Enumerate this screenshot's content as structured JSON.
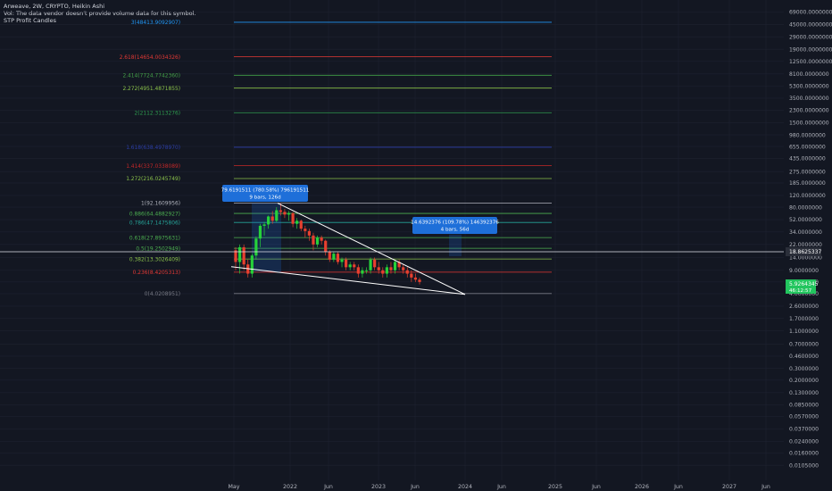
{
  "header": {
    "title": "Arweave, 2W, CRYPTO, Heikin Ashi",
    "vol_note": "Vol: The data vendor doesn't provide volume data for this symbol.",
    "indicator": "STP Profit Candles"
  },
  "colors": {
    "background": "#131722",
    "grid": "#1e2230",
    "axis_text": "#b2b5be",
    "up": "#26d13a",
    "down": "#e8402f",
    "trendline": "#ffffff",
    "measure": "#1e6fd9",
    "last_price": "#22c55e",
    "crosshair_price": "#2a2e39"
  },
  "chart_data": {
    "type": "candlestick",
    "scale": "log",
    "price_labels": [
      "69000.0000000",
      "45000.0000000",
      "29000.0000000",
      "19000.0000000",
      "12500.0000000",
      "8100.0000000",
      "5300.0000000",
      "3500.0000000",
      "2300.0000000",
      "1500.0000000",
      "980.0000000",
      "655.0000000",
      "435.0000000",
      "275.0000000",
      "185.0000000",
      "120.0000000",
      "80.0000000",
      "52.0000000",
      "34.0000000",
      "22.0000000",
      "14.0000000",
      "9.0000000",
      "6.0000000",
      "4.0000000",
      "2.6000000",
      "1.7000000",
      "1.1000000",
      "0.7000000",
      "0.4600000",
      "0.3000000",
      "0.2000000",
      "0.1300000",
      "0.0850000",
      "0.0570000",
      "0.0370000",
      "0.0240000",
      "0.0160000",
      "0.0105000"
    ],
    "time_labels": [
      "May",
      "2022",
      "Jun",
      "2023",
      "Jun",
      "2024",
      "Jun",
      "2025",
      "Jun",
      "2026",
      "Jun",
      "2027",
      "Jun"
    ],
    "fib_levels": [
      {
        "label": "3(48413.9092907)",
        "price": 48413.9,
        "color": "#2196f3"
      },
      {
        "label": "2.618(14654.0034326)",
        "price": 14654.0,
        "color": "#e53935"
      },
      {
        "label": "2.414(7724.7742360)",
        "price": 7724.77,
        "color": "#43a047"
      },
      {
        "label": "2.272(4951.4871855)",
        "price": 4951.49,
        "color": "#8bc34a"
      },
      {
        "label": "2(2112.3113276)",
        "price": 2112.31,
        "color": "#2e9d4f"
      },
      {
        "label": "1.618(638.4978970)",
        "price": 638.5,
        "color": "#2c3ea8"
      },
      {
        "label": "1.414(337.0338089)",
        "price": 337.03,
        "color": "#c62828"
      },
      {
        "label": "1.272(216.0245749)",
        "price": 216.02,
        "color": "#8bc34a"
      },
      {
        "label": "1(92.1609956)",
        "price": 92.16,
        "color": "#b0b3bd"
      },
      {
        "label": "0.886(64.4882927)",
        "price": 64.49,
        "color": "#4caf50"
      },
      {
        "label": "0.786(47.1475806)",
        "price": 47.15,
        "color": "#26a69a"
      },
      {
        "label": "0.618(27.8975631)",
        "price": 27.9,
        "color": "#4caf50"
      },
      {
        "label": "0.5(19.2502949)",
        "price": 19.25,
        "color": "#4caf50"
      },
      {
        "label": "0.382(13.3026409)",
        "price": 13.3,
        "color": "#8bc34a"
      },
      {
        "label": "0.236(8.4205313)",
        "price": 8.42,
        "color": "#e53935"
      },
      {
        "label": "0(4.0208951)",
        "price": 4.02,
        "color": "#787b86"
      }
    ],
    "measures": [
      {
        "line1": "79.6191511 (780.58%) 796191511",
        "line2": "9 bars, 126d"
      },
      {
        "line1": "14.6392376 (109.78%) 146392376",
        "line2": "4 bars, 56d"
      }
    ],
    "crosshair_price": "18.8625337",
    "last_price": "5.9264345",
    "last_price_sub": "46:12:57",
    "candles": [
      [
        18,
        20,
        9,
        12
      ],
      [
        12,
        22,
        8,
        20
      ],
      [
        20,
        22,
        9,
        11
      ],
      [
        11,
        13,
        7,
        8
      ],
      [
        8,
        16,
        7,
        15
      ],
      [
        15,
        29,
        13,
        27
      ],
      [
        27,
        45,
        20,
        42
      ],
      [
        42,
        48,
        30,
        44
      ],
      [
        44,
        60,
        38,
        58
      ],
      [
        58,
        70,
        45,
        50
      ],
      [
        50,
        80,
        48,
        72
      ],
      [
        72,
        92,
        60,
        68
      ],
      [
        68,
        75,
        55,
        62
      ],
      [
        62,
        70,
        50,
        65
      ],
      [
        65,
        68,
        40,
        45
      ],
      [
        45,
        55,
        38,
        50
      ],
      [
        50,
        52,
        35,
        38
      ],
      [
        38,
        42,
        28,
        35
      ],
      [
        35,
        38,
        25,
        30
      ],
      [
        30,
        33,
        18,
        22
      ],
      [
        22,
        30,
        20,
        28
      ],
      [
        28,
        30,
        22,
        25
      ],
      [
        25,
        26,
        15,
        17
      ],
      [
        17,
        18,
        12,
        13
      ],
      [
        13,
        17,
        12,
        16
      ],
      [
        16,
        17,
        11,
        12
      ],
      [
        12,
        14,
        10,
        13
      ],
      [
        13,
        14,
        9,
        10
      ],
      [
        10,
        12,
        9,
        11
      ],
      [
        11,
        12,
        9,
        10
      ],
      [
        10,
        11,
        7,
        8
      ],
      [
        8,
        10,
        7,
        9
      ],
      [
        9,
        10,
        8,
        9
      ],
      [
        9,
        14,
        8,
        13
      ],
      [
        13,
        14,
        9,
        10
      ],
      [
        10,
        12,
        8,
        9
      ],
      [
        9,
        10,
        7,
        8
      ],
      [
        8,
        11,
        7,
        10
      ],
      [
        10,
        12,
        8,
        9
      ],
      [
        9,
        13,
        8,
        12
      ],
      [
        12,
        13,
        9,
        10
      ],
      [
        10,
        11,
        8,
        9
      ],
      [
        9,
        10,
        7,
        8
      ],
      [
        8,
        9,
        6,
        7
      ],
      [
        7,
        8,
        6,
        6.5
      ],
      [
        6.5,
        7,
        5.5,
        6
      ]
    ]
  }
}
